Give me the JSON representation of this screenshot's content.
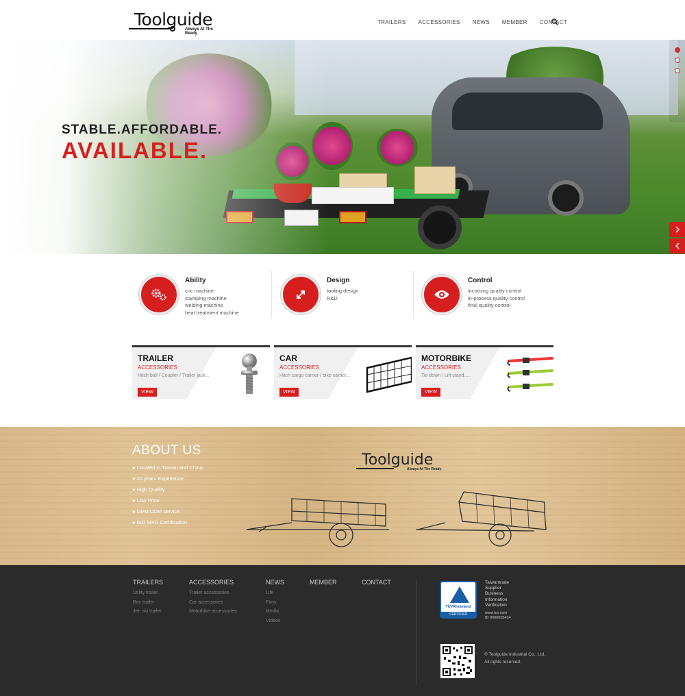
{
  "brand": {
    "logo_text": "Toolguide",
    "tagline": "Always At The Ready"
  },
  "nav": {
    "items": [
      "TRAILERS",
      "ACCESSORIES",
      "NEWS",
      "MEMBER",
      "CONTACT"
    ]
  },
  "hero": {
    "line1": "STABLE.AFFORDABLE.",
    "line2": "AVAILABLE.",
    "slide_active": 1,
    "slide_count": 3
  },
  "features": [
    {
      "title": "Ability",
      "lines": [
        "cnc machine",
        "stamping machine",
        "welding machine",
        "heat treatment machine"
      ],
      "icon": "gears-icon"
    },
    {
      "title": "Design",
      "lines": [
        "tooling design",
        "R&D"
      ],
      "icon": "expand-arrows-icon"
    },
    {
      "title": "Control",
      "lines": [
        "incoming quality control",
        "in-process quality control",
        "final quality control"
      ],
      "icon": "eye-icon"
    }
  ],
  "cards": [
    {
      "name": "TRAILER",
      "sub": "ACCESSORIES",
      "desc": "Hitch ball / Coupler / Trailer jack...",
      "view": "VIEW"
    },
    {
      "name": "CAR",
      "sub": "ACCESSORIES",
      "desc": "Hitch cargo carrier / bike carrier...",
      "view": "VIEW"
    },
    {
      "name": "MOTORBIKE",
      "sub": "ACCESSORIES",
      "desc": "Tie down / Lift stand.....",
      "view": "VIEW"
    }
  ],
  "about": {
    "title": "ABOUT US",
    "points": [
      "● Located in Taiwan and China.",
      "● 20 years Experience.",
      "● High Quality.",
      "● Low Price.",
      "● OEM/ODM service.",
      "● ISO 9001 Certification."
    ]
  },
  "footer": {
    "cols": [
      {
        "h": "TRAILERS",
        "items": [
          "Utility trailer",
          "Box trailer",
          "Jet- ski trailer"
        ]
      },
      {
        "h": "ACCESSORIES",
        "items": [
          "Trailer accessories",
          "Car accessories",
          "Motorbike accessories"
        ]
      },
      {
        "h": "NEWS",
        "items": [
          "Life",
          "Fans",
          "Media",
          "Videos"
        ]
      },
      {
        "h": "MEMBER",
        "items": []
      },
      {
        "h": "CONTACT",
        "items": []
      }
    ],
    "badge_brand": "TÜVRheinland",
    "badge_cert": "CERTIFIED",
    "verify_lines": [
      "Taiwantrade",
      "Supplier",
      "Business",
      "Information",
      "Verification"
    ],
    "verify_small": [
      "www.tuv.com",
      "ID 0000055414"
    ],
    "copyright": "© Toolguide Industrial Co., Ltd.",
    "rights": "All rights reserved.",
    "colors": {
      "accent": "#d71e1e",
      "footer_bg": "#2b2b2b",
      "wood": "#dcbd8e"
    }
  }
}
